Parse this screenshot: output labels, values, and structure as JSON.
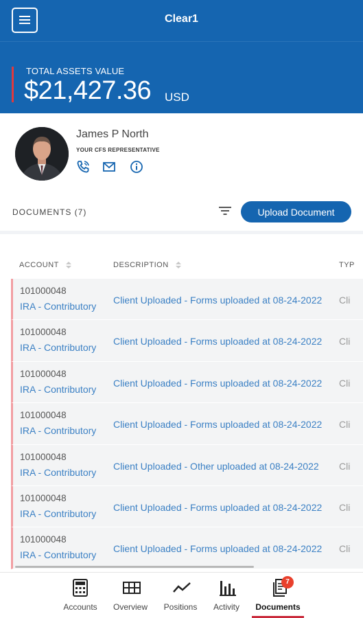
{
  "header": {
    "title": "Clear1"
  },
  "assets": {
    "label": "TOTAL ASSETS VALUE",
    "value": "$21,427.36",
    "currency": "USD"
  },
  "representative": {
    "name": "James P North",
    "role": "YOUR CFS REPRESENTATIVE"
  },
  "documents": {
    "title": "DOCUMENTS (7)",
    "upload_label": "Upload Document",
    "columns": [
      "ACCOUNT",
      "DESCRIPTION",
      "TYP"
    ],
    "rows": [
      {
        "account": "101000048",
        "type": "IRA - Contributory",
        "description": "Client Uploaded - Forms uploaded at 08-24-2022",
        "doc_type": "Cli"
      },
      {
        "account": "101000048",
        "type": "IRA - Contributory",
        "description": "Client Uploaded - Forms uploaded at 08-24-2022",
        "doc_type": "Cli"
      },
      {
        "account": "101000048",
        "type": "IRA - Contributory",
        "description": "Client Uploaded - Forms uploaded at 08-24-2022",
        "doc_type": "Cli"
      },
      {
        "account": "101000048",
        "type": "IRA - Contributory",
        "description": "Client Uploaded - Forms uploaded at 08-24-2022",
        "doc_type": "Cli"
      },
      {
        "account": "101000048",
        "type": "IRA - Contributory",
        "description": "Client Uploaded - Other uploaded at 08-24-2022",
        "doc_type": "Cli"
      },
      {
        "account": "101000048",
        "type": "IRA - Contributory",
        "description": "Client Uploaded - Forms uploaded at 08-24-2022",
        "doc_type": "Cli"
      },
      {
        "account": "101000048",
        "type": "IRA - Contributory",
        "description": "Client Uploaded - Forms uploaded at 08-24-2022",
        "doc_type": "Cli"
      }
    ]
  },
  "nav": {
    "accounts": "Accounts",
    "overview": "Overview",
    "positions": "Positions",
    "activity": "Activity",
    "documents": "Documents",
    "documents_badge": "7",
    "active": "documents"
  },
  "colors": {
    "brand_blue": "#1565b0",
    "accent_red": "#e03a3e",
    "link_blue": "#3b80c4",
    "badge_red": "#e9402c"
  }
}
